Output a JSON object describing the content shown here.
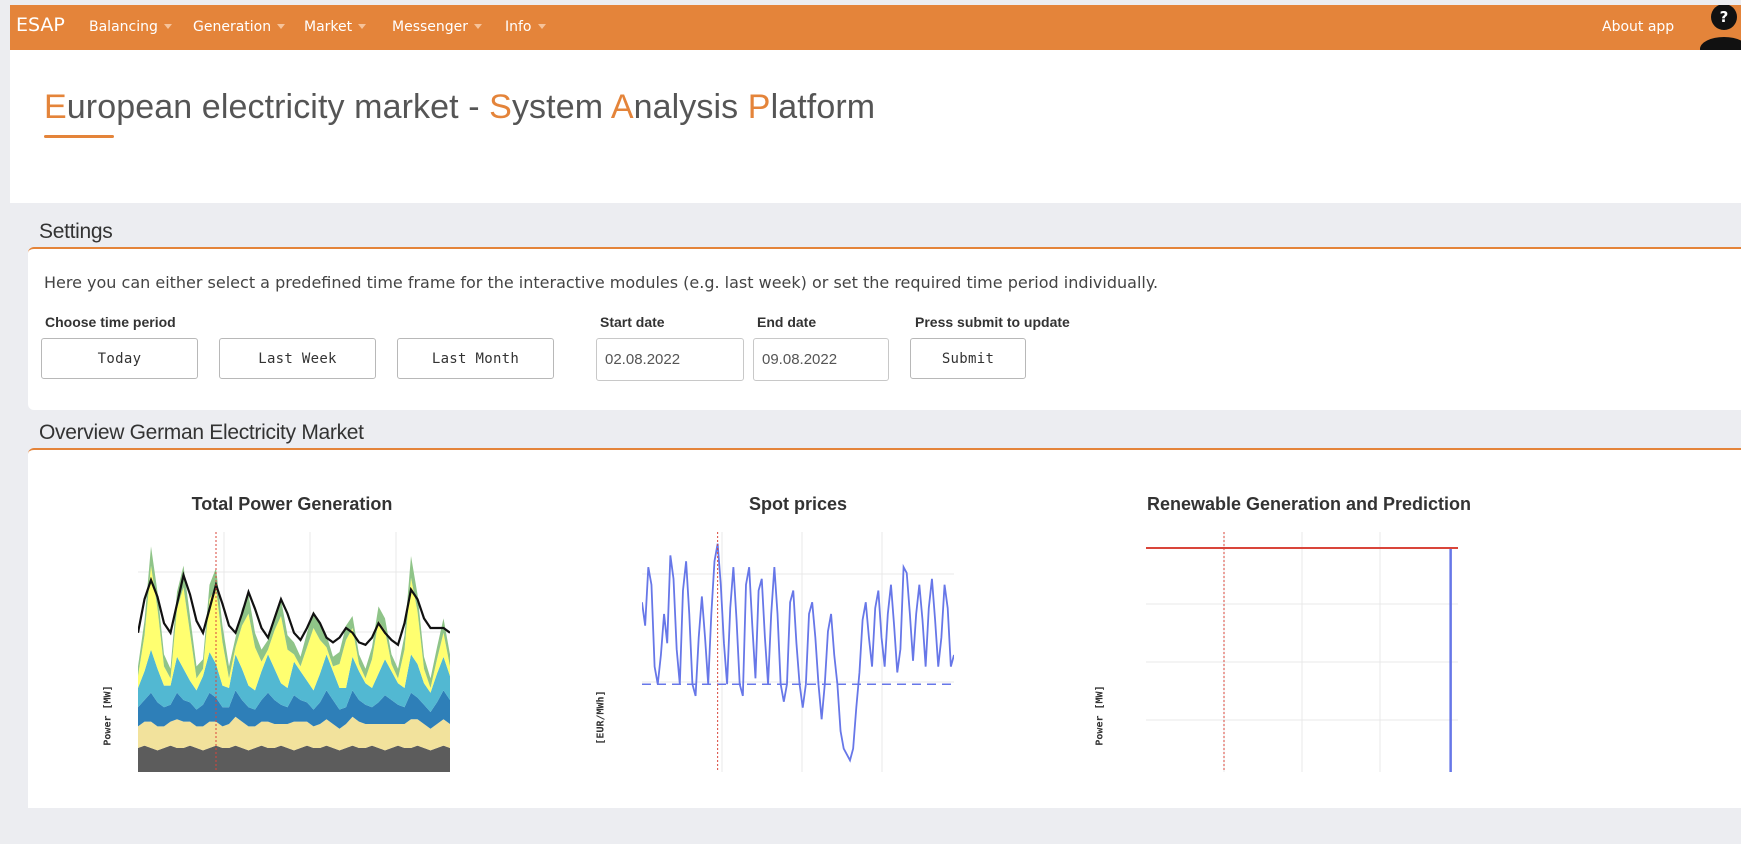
{
  "nav": {
    "brand": "ESAP",
    "items": [
      "Balancing",
      "Generation",
      "Market",
      "Messenger",
      "Info"
    ],
    "about": "About app",
    "help": "?"
  },
  "header": {
    "title_parts": [
      {
        "t": "E",
        "accent": true
      },
      {
        "t": "uropean electricity market - ",
        "accent": false
      },
      {
        "t": "S",
        "accent": true
      },
      {
        "t": "ystem ",
        "accent": false
      },
      {
        "t": "A",
        "accent": true
      },
      {
        "t": "nalysis ",
        "accent": false
      },
      {
        "t": "P",
        "accent": true
      },
      {
        "t": "latform",
        "accent": false
      }
    ]
  },
  "settings": {
    "title": "Settings",
    "description": "Here you can either select a predefined time frame for the interactive modules (e.g. last week) or set the required time period individually.",
    "choose_label": "Choose time period",
    "buttons": [
      "Today",
      "Last Week",
      "Last Month"
    ],
    "start_label": "Start date",
    "start_value": "02.08.2022",
    "end_label": "End date",
    "end_value": "09.08.2022",
    "submit_label": "Press submit to update",
    "submit_button": "Submit"
  },
  "overview": {
    "title": "Overview German Electricity Market"
  },
  "colors": {
    "accent": "#e4843a",
    "line_blue": "#6777e8",
    "marker_red": "#d9453a"
  },
  "chart_data": [
    {
      "type": "area",
      "title": "Total Power Generation",
      "ylabel": "Power [MW]",
      "x": [
        0,
        1,
        2,
        3,
        4,
        5,
        6,
        7,
        8,
        9,
        10,
        11,
        12,
        13,
        14,
        15,
        16,
        17,
        18,
        19,
        20,
        21,
        22,
        23,
        24,
        25,
        26,
        27,
        28,
        29,
        30,
        31,
        32,
        33,
        34,
        35,
        36,
        37,
        38,
        39,
        40,
        41,
        42,
        43,
        44,
        45,
        46,
        47,
        48
      ],
      "series": [
        {
          "name": "",
          "color": "#5c5c5c",
          "values": [
            10,
            11,
            10,
            9,
            10,
            11,
            10,
            10,
            11,
            10,
            9,
            10,
            11,
            10,
            10,
            11,
            10,
            9,
            10,
            11,
            10,
            10,
            11,
            10,
            9,
            10,
            11,
            10,
            10,
            11,
            10,
            9,
            10,
            11,
            10,
            10,
            11,
            10,
            9,
            10,
            11,
            10,
            10,
            11,
            10,
            9,
            10,
            11,
            10
          ]
        },
        {
          "name": "",
          "color": "#f2e29c",
          "values": [
            9,
            10,
            11,
            10,
            9,
            10,
            12,
            11,
            10,
            9,
            10,
            11,
            10,
            9,
            10,
            12,
            11,
            10,
            9,
            10,
            11,
            10,
            9,
            10,
            12,
            11,
            10,
            9,
            10,
            11,
            10,
            9,
            10,
            12,
            11,
            10,
            9,
            10,
            11,
            10,
            9,
            10,
            12,
            11,
            10,
            9,
            10,
            11,
            10
          ]
        },
        {
          "name": "",
          "color": "#2e7fb8",
          "values": [
            8,
            9,
            12,
            10,
            8,
            7,
            11,
            9,
            8,
            7,
            9,
            12,
            10,
            8,
            7,
            11,
            9,
            8,
            7,
            9,
            12,
            10,
            8,
            7,
            11,
            9,
            8,
            7,
            9,
            12,
            10,
            8,
            7,
            11,
            9,
            8,
            7,
            9,
            12,
            10,
            8,
            7,
            11,
            9,
            8,
            7,
            9,
            12,
            10
          ]
        },
        {
          "name": "",
          "color": "#52b8d2",
          "values": [
            8,
            12,
            18,
            14,
            9,
            8,
            15,
            13,
            9,
            8,
            12,
            17,
            14,
            9,
            8,
            15,
            13,
            9,
            8,
            12,
            16,
            13,
            9,
            8,
            14,
            12,
            9,
            8,
            12,
            15,
            12,
            9,
            8,
            14,
            12,
            9,
            8,
            12,
            15,
            12,
            9,
            8,
            16,
            14,
            9,
            8,
            12,
            14,
            10
          ]
        },
        {
          "name": "",
          "color": "#ffff70",
          "values": [
            5,
            15,
            35,
            25,
            8,
            3,
            20,
            34,
            20,
            5,
            3,
            22,
            32,
            18,
            4,
            3,
            18,
            30,
            18,
            4,
            2,
            16,
            28,
            16,
            3,
            2,
            14,
            26,
            14,
            3,
            2,
            10,
            20,
            12,
            3,
            2,
            12,
            22,
            12,
            3,
            2,
            16,
            32,
            22,
            6,
            2,
            6,
            10,
            4
          ]
        },
        {
          "name": "",
          "color": "#8fc488",
          "values": [
            4,
            6,
            8,
            7,
            5,
            4,
            7,
            9,
            7,
            5,
            4,
            6,
            8,
            7,
            5,
            4,
            7,
            8,
            6,
            5,
            4,
            6,
            7,
            6,
            5,
            4,
            6,
            7,
            6,
            5,
            4,
            5,
            6,
            5,
            4,
            4,
            5,
            6,
            5,
            4,
            4,
            6,
            9,
            7,
            5,
            4,
            5,
            6,
            5
          ]
        }
      ],
      "overlay_line": [
        58,
        72,
        80,
        73,
        62,
        58,
        70,
        82,
        74,
        63,
        58,
        68,
        78,
        70,
        61,
        58,
        66,
        75,
        68,
        60,
        56,
        64,
        72,
        66,
        58,
        55,
        60,
        66,
        62,
        56,
        54,
        56,
        60,
        58,
        54,
        53,
        56,
        62,
        58,
        55,
        53,
        62,
        76,
        72,
        64,
        60,
        60,
        60,
        58
      ],
      "marker_x": 12
    },
    {
      "type": "line",
      "title": "Spot prices",
      "ylabel": "[EUR/MWh]",
      "x": [
        0,
        1,
        2,
        3,
        4,
        5,
        6,
        7,
        8,
        9,
        10,
        11,
        12,
        13,
        14,
        15,
        16,
        17,
        18,
        19,
        20,
        21,
        22,
        23,
        24,
        25,
        26,
        27,
        28,
        29,
        30,
        31,
        32,
        33,
        34,
        35,
        36,
        37,
        38,
        39,
        40,
        41,
        42,
        43,
        44,
        45,
        46,
        47,
        48,
        49,
        50,
        51,
        52,
        53,
        54,
        55,
        56,
        57,
        58,
        59,
        60,
        61,
        62,
        63,
        64,
        65,
        66,
        67,
        68,
        69,
        70,
        71,
        72,
        73,
        74,
        75,
        76,
        77,
        78,
        79,
        80,
        81,
        82,
        83,
        84,
        85,
        86,
        87,
        88,
        89,
        90,
        91,
        92,
        93,
        94,
        95,
        96,
        97,
        98,
        99
      ],
      "values": [
        440,
        400,
        500,
        470,
        330,
        300,
        350,
        420,
        370,
        520,
        480,
        360,
        300,
        460,
        510,
        420,
        300,
        280,
        380,
        450,
        380,
        300,
        420,
        510,
        540,
        470,
        370,
        300,
        430,
        500,
        410,
        300,
        280,
        470,
        500,
        400,
        310,
        460,
        480,
        380,
        300,
        420,
        500,
        420,
        300,
        270,
        300,
        440,
        460,
        370,
        300,
        260,
        300,
        420,
        440,
        380,
        300,
        240,
        300,
        390,
        420,
        350,
        300,
        220,
        190,
        180,
        170,
        190,
        260,
        320,
        410,
        440,
        380,
        330,
        430,
        460,
        380,
        330,
        420,
        470,
        400,
        320,
        360,
        500,
        490,
        420,
        340,
        420,
        470,
        410,
        330,
        430,
        480,
        410,
        330,
        380,
        470,
        430,
        330,
        350
      ],
      "mean": 300,
      "marker_x": 24
    },
    {
      "type": "line",
      "title": "Renewable Generation and Prediction",
      "ylabel": "Power [MW]",
      "x": [
        0,
        97,
        98,
        100
      ],
      "values": [
        0,
        0,
        1,
        1
      ],
      "marker_x": 25
    }
  ]
}
